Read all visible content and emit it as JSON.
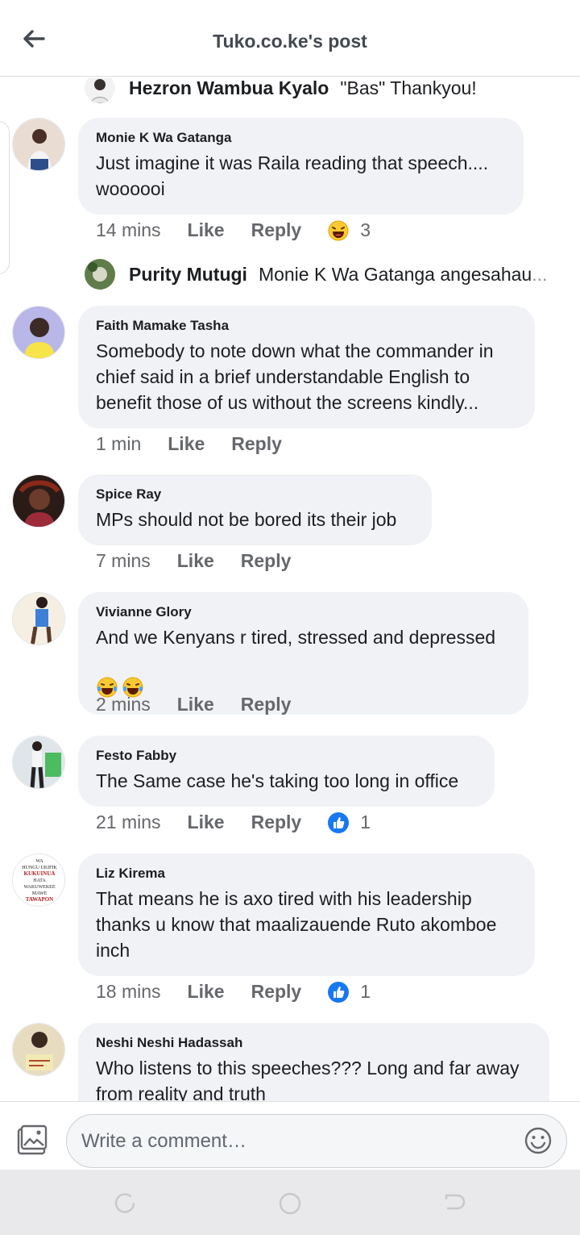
{
  "header": {
    "title": "Tuko.co.ke's post"
  },
  "reply_previews": [
    {
      "name": "Hezron Wambua Kyalo",
      "text": "\"Bas\" Thankyou!"
    },
    {
      "name": "Purity Mutugi",
      "text": "Monie K Wa Gatanga angesahau",
      "ellipsis": "..."
    }
  ],
  "comments": [
    {
      "name": "Monie K Wa Gatanga",
      "text": "Just imagine it was Raila reading that speech....\nwoooooi",
      "time": "14 mins",
      "like": "Like",
      "reply": "Reply",
      "reaction_icon": "laughing-emoji",
      "reaction_count": "3"
    },
    {
      "name": "Faith Mamake Tasha",
      "text": "Somebody to note down what the commander in\nchief said in a brief understandable English to\nbenefit those of us without the screens kindly...",
      "time": "1 min",
      "like": "Like",
      "reply": "Reply"
    },
    {
      "name": "Spice Ray",
      "text": "MPs should not be bored its their job",
      "time": "7 mins",
      "like": "Like",
      "reply": "Reply"
    },
    {
      "name": "Vivianne Glory",
      "text": "And we Kenyans r tired, stressed and depressed",
      "emojis": [
        "tears-of-joy-emoji",
        "tears-of-joy-emoji"
      ],
      "time": "2 mins",
      "like": "Like",
      "reply": "Reply"
    },
    {
      "name": "Festo Fabby",
      "text": "The Same case he's taking too long in office",
      "time": "21 mins",
      "like": "Like",
      "reply": "Reply",
      "reaction_icon": "thumbs-up-icon",
      "reaction_count": "1"
    },
    {
      "name": "Liz Kirema",
      "text": "That means he is axo tired with his leadership\nthanks u know that maalizauende Ruto akomboe\ninch",
      "time": "18 mins",
      "like": "Like",
      "reply": "Reply",
      "reaction_icon": "thumbs-up-icon",
      "reaction_count": "1",
      "avatar_text": [
        "WA",
        "HUNGU UKIFIK",
        "KUKUINUA",
        "HATA",
        "WAKUWEKEE",
        "MAWE",
        "TAWAPON"
      ]
    },
    {
      "name": "Neshi Neshi Hadassah",
      "text": "Who listens to this speeches??? Long and far away\nfrom reality and truth"
    }
  ],
  "composer": {
    "placeholder": "Write a comment…"
  },
  "colors": {
    "bubble": "#f0f2f5",
    "like_blue": "#1877f2",
    "text": "#1c1e21",
    "muted": "#65676b"
  }
}
